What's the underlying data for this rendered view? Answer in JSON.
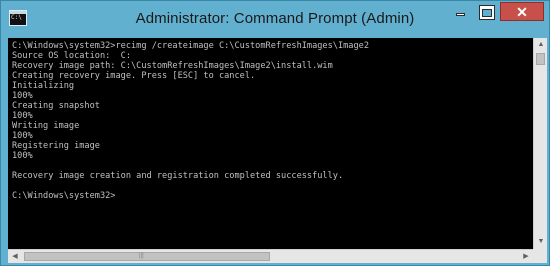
{
  "window": {
    "title": "Administrator: Command Prompt (Admin)",
    "icon": "command-prompt-icon",
    "controls": {
      "minimize": "minimize-icon",
      "maximize": "maximize-icon",
      "close_label": "✕"
    }
  },
  "console": {
    "lines": [
      "C:\\Windows\\system32>recimg /createimage C:\\CustomRefreshImages\\Image2",
      "Source OS location:  C:",
      "Recovery image path: C:\\CustomRefreshImages\\Image2\\install.wim",
      "Creating recovery image. Press [ESC] to cancel.",
      "Initializing",
      "100%",
      "Creating snapshot",
      "100%",
      "Writing image",
      "100%",
      "Registering image",
      "100%",
      "",
      "Recovery image creation and registration completed successfully.",
      "",
      "C:\\Windows\\system32>"
    ]
  },
  "scrollbars": {
    "up_arrow": "▲",
    "down_arrow": "▼",
    "left_arrow": "◀",
    "right_arrow": "▶",
    "grip": "|||"
  },
  "colors": {
    "frame": "#62b0cf",
    "console_bg": "#000000",
    "console_text": "#c0c0c0",
    "close_button": "#c7504a"
  }
}
